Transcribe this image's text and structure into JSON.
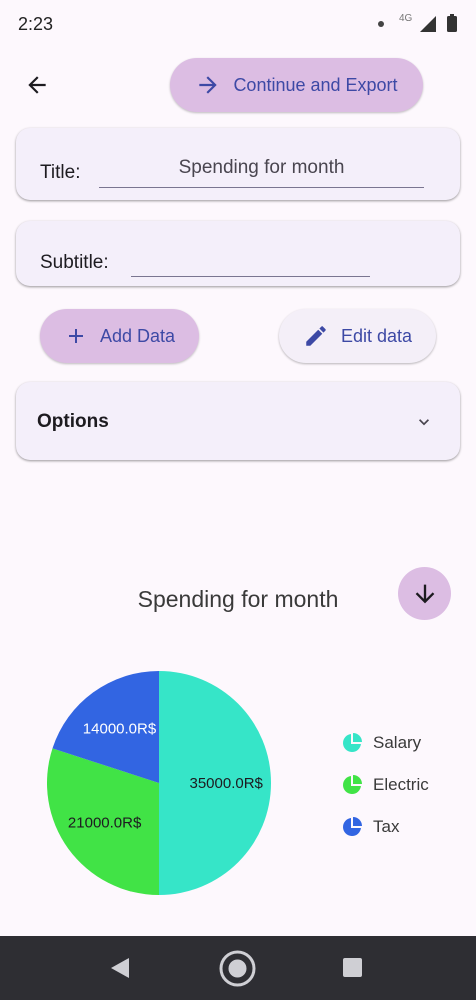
{
  "status_bar": {
    "time": "2:23",
    "network_label": "4G"
  },
  "header": {
    "back_icon": "arrow-back-icon",
    "export_button_label": "Continue and Export",
    "export_icon": "arrow-forward-icon"
  },
  "form": {
    "title_label": "Title:",
    "title_value": "Spending for month",
    "subtitle_label": "Subtitle:",
    "subtitle_value": ""
  },
  "actions": {
    "add_data_label": "Add Data",
    "add_icon": "plus-icon",
    "edit_data_label": "Edit data",
    "edit_icon": "pencil-icon"
  },
  "options": {
    "label": "Options",
    "expanded": false
  },
  "chart_data": {
    "type": "pie",
    "title": "Spending for month",
    "categories": [
      "Salary",
      "Electric",
      "Tax"
    ],
    "values": [
      35000.0,
      21000.0,
      14000.0
    ],
    "value_labels": [
      "35000.0R$",
      "21000.0R$",
      "14000.0R$"
    ],
    "colors": [
      "#36e5c8",
      "#41e346",
      "#3265e2"
    ],
    "legend_position": "right"
  },
  "colors": {
    "accent_button": "#dcbde3",
    "accent_text": "#3d49a5",
    "card_background": "#f4effa",
    "page_background": "#fdf8fd",
    "nav_bar": "#2e2e33"
  }
}
